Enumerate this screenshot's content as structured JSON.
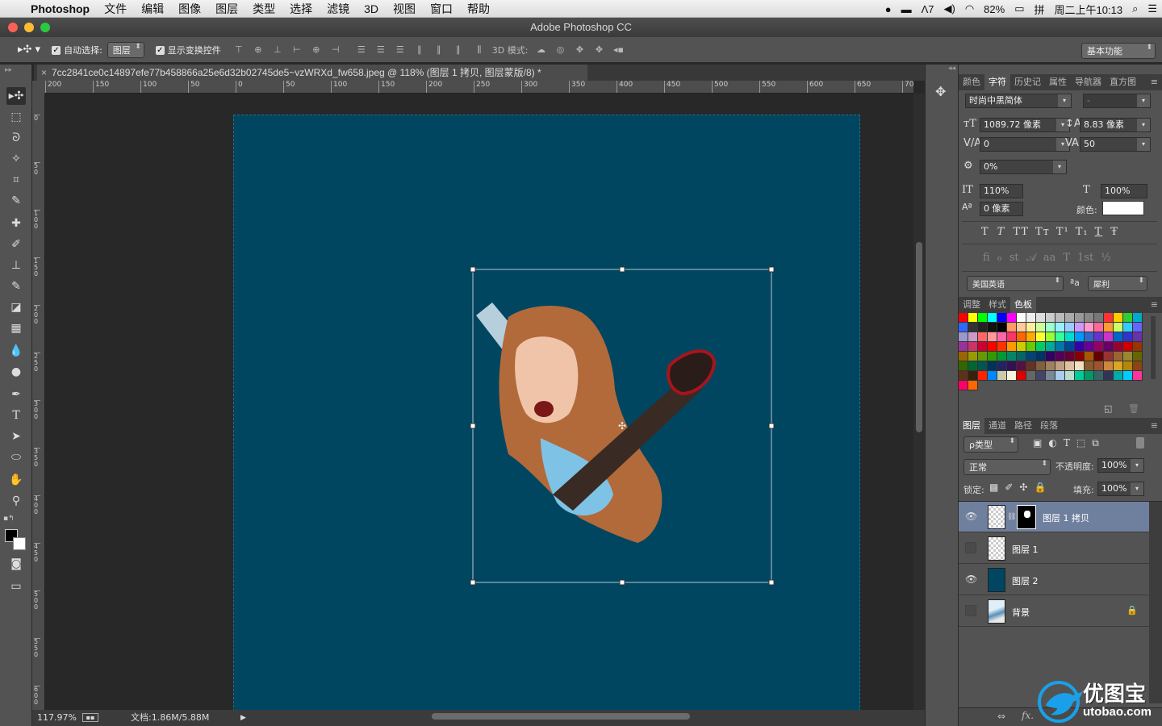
{
  "menubar": {
    "app": "Photoshop",
    "items": [
      "文件",
      "编辑",
      "图像",
      "图层",
      "类型",
      "选择",
      "滤镜",
      "3D",
      "视图",
      "窗口",
      "帮助"
    ],
    "status": {
      "battery": "82%",
      "clock": "周二上午10:13",
      "num": "7"
    }
  },
  "window": {
    "title": "Adobe Photoshop CC"
  },
  "options": {
    "auto_select_label": "自动选择:",
    "auto_select_value": "图层",
    "show_transform_label": "显示变换控件",
    "mode_3d_label": "3D 模式:",
    "workspace": "基本功能"
  },
  "document": {
    "tab_title": "7cc2841ce0c14897efe77b458866a25e6d32b02745de5~vzWRXd_fw658.jpeg @ 118% (图层 1 拷贝, 图层蒙版/8) *",
    "close_glyph": "×",
    "hruler_labels": [
      "200",
      "150",
      "100",
      "50",
      "0",
      "50",
      "100",
      "150",
      "200",
      "250",
      "300",
      "350",
      "400",
      "450",
      "500",
      "550",
      "600",
      "650",
      "700"
    ],
    "vruler_labels": [
      "0",
      "5 0",
      "1 0 0",
      "1 5 0",
      "2 0 0",
      "2 5 0",
      "3 0 0",
      "3 5 0",
      "4 0 0",
      "4 5 0",
      "5 0 0",
      "5 5 0",
      "6 0 0"
    ],
    "canvas_color": "#004660"
  },
  "status": {
    "zoom": "117.97%",
    "doc": "文档:1.86M/5.88M"
  },
  "character_panel": {
    "tabs": [
      "颜色",
      "字符",
      "历史记",
      "属性",
      "导航器",
      "直方图"
    ],
    "active_tab": "字符",
    "font_family": "时尚中黑简体",
    "font_style": "-",
    "font_size": "1089.72 像素",
    "leading": "8.83 像素",
    "kerning": "0",
    "tracking": "50",
    "tsume": "0%",
    "vscale": "110%",
    "hscale": "100%",
    "baseline": "0 像素",
    "color_label": "颜色:",
    "language": "美国英语",
    "aa_label": "ªa",
    "antialias": "犀利",
    "type_buttons": [
      "T",
      "T",
      "TT",
      "Tт",
      "T¹",
      "T₁",
      "T",
      "Ŧ"
    ],
    "ot_buttons": [
      "ﬁ",
      "ℴ",
      "st",
      "𝒜",
      "aa",
      "T",
      "1st",
      "½"
    ]
  },
  "swatches_panel": {
    "tabs": [
      "调整",
      "样式",
      "色板"
    ],
    "active_tab": "色板",
    "colors": [
      "#ff0000",
      "#ffff00",
      "#00ff00",
      "#00ffff",
      "#0000ff",
      "#ff00ff",
      "#ffffff",
      "#eeeeee",
      "#dddddd",
      "#cccccc",
      "#bbbbbb",
      "#aaaaaa",
      "#999999",
      "#888888",
      "#777777",
      "#ff3333",
      "#ffcc00",
      "#33cc33",
      "#00aacc",
      "#3366ff",
      "#333333",
      "#222222",
      "#111111",
      "#000000",
      "#ff9966",
      "#ffcc99",
      "#ffee99",
      "#ccff99",
      "#99ffcc",
      "#99eeff",
      "#99ccff",
      "#cc99ff",
      "#ff99cc",
      "#ff6699",
      "#ff9933",
      "#ccff66",
      "#33ccff",
      "#6666ff",
      "#9999cc",
      "#cc99cc",
      "#ff6666",
      "#ff9999",
      "#ff66aa",
      "#ff3366",
      "#ff6600",
      "#ffaa00",
      "#ffff33",
      "#99ff33",
      "#33ff99",
      "#00ddcc",
      "#0099ff",
      "#3366cc",
      "#6633cc",
      "#cc33cc",
      "#0066cc",
      "#3333cc",
      "#6633aa",
      "#993399",
      "#cc3366",
      "#cc0033",
      "#ff0000",
      "#ff3300",
      "#ff9900",
      "#cccc00",
      "#66cc00",
      "#00cc66",
      "#00aa99",
      "#0077aa",
      "#004499",
      "#3300aa",
      "#660099",
      "#990066",
      "#660066",
      "#990033",
      "#cc0000",
      "#993300",
      "#996600",
      "#999900",
      "#669900",
      "#339900",
      "#009933",
      "#008866",
      "#006666",
      "#004477",
      "#003366",
      "#330066",
      "#550055",
      "#660033",
      "#880000",
      "#aa5500",
      "#660000",
      "#993333",
      "#996633",
      "#998833",
      "#666600",
      "#336600",
      "#006633",
      "#005555",
      "#003355",
      "#222266",
      "#331155",
      "#551144",
      "#663322",
      "#806040",
      "#a08060",
      "#c0a080",
      "#e0c0a0",
      "#f0e0c0",
      "#8b5a2b",
      "#a0522d",
      "#cd853f",
      "#daa520",
      "#b8860b",
      "#8b4513",
      "#5c3317",
      "#3b1f0e",
      "#ff2200",
      "#0088ff",
      "#ccccaa",
      "#f5f5dc",
      "#e00000",
      "#666666",
      "#444466",
      "#778899",
      "#aaccee",
      "#bbddcc",
      "#00cc99",
      "#009966",
      "#336666",
      "#333355",
      "#00aaaa",
      "#00ccff",
      "#ff3399",
      "#ff0066",
      "#ff6600"
    ],
    "footer_icons": [
      "new-swatch-icon",
      "trash-icon"
    ]
  },
  "layers_panel": {
    "tabs": [
      "图层",
      "通道",
      "路径",
      "段落"
    ],
    "active_tab": "图层",
    "filter": "ρ类型",
    "blend_mode": "正常",
    "opacity_label": "不透明度:",
    "opacity": "100%",
    "lock_label": "锁定:",
    "fill_label": "填充:",
    "fill": "100%",
    "layers": [
      {
        "name": "图层 1 拷贝",
        "visible": true,
        "selected": true,
        "thumb": "checker",
        "mask": true
      },
      {
        "name": "图层 1",
        "visible": false,
        "selected": false,
        "thumb": "checker",
        "mask": false
      },
      {
        "name": "图层 2",
        "visible": true,
        "selected": false,
        "thumb": "#004660",
        "mask": false
      },
      {
        "name": "背景",
        "visible": false,
        "selected": false,
        "thumb": "photo",
        "mask": false,
        "locked": true
      }
    ],
    "footer_icons": [
      "link-icon",
      "fx-icon"
    ]
  },
  "watermark": {
    "brand": "优图宝",
    "url": "utobao.com"
  }
}
